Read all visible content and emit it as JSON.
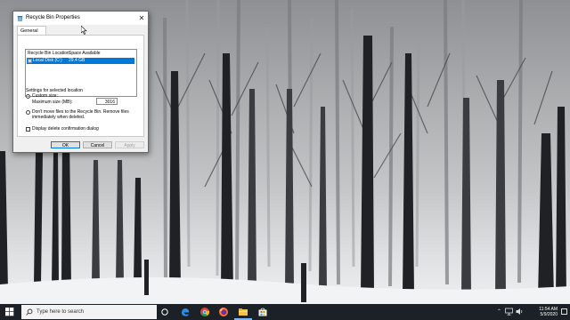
{
  "dialog": {
    "title": "Recycle Bin Properties",
    "close_glyph": "✕",
    "tab_label": "General",
    "list": {
      "columns": [
        "Recycle Bin Location",
        "Space Available"
      ],
      "rows": [
        {
          "location": "Local Disk (C:)",
          "space": "29.4 GB",
          "selected": true
        }
      ]
    },
    "settings_heading": "Settings for selected location",
    "custom_size_label": "Custom size:",
    "custom_size_selected": true,
    "max_size_label": "Maximum size (MB):",
    "max_size_value": "3016",
    "no_move_label": "Don't move files to the Recycle Bin. Remove files immediately when deleted.",
    "no_move_selected": false,
    "confirm_label": "Display delete confirmation dialog",
    "confirm_checked": false,
    "buttons": {
      "ok": "OK",
      "cancel": "Cancel",
      "apply": "Apply"
    }
  },
  "taskbar": {
    "search_placeholder": "Type here to search",
    "icons": [
      "windows-start-icon",
      "task-view-icon",
      "edge-icon",
      "chrome-icon",
      "firefox-icon",
      "file-explorer-icon",
      "store-icon"
    ],
    "clock_time": "11:54 AM",
    "clock_date": "5/9/2020"
  },
  "colors": {
    "selection": "#0078d7",
    "taskbar": "#1b2126"
  }
}
